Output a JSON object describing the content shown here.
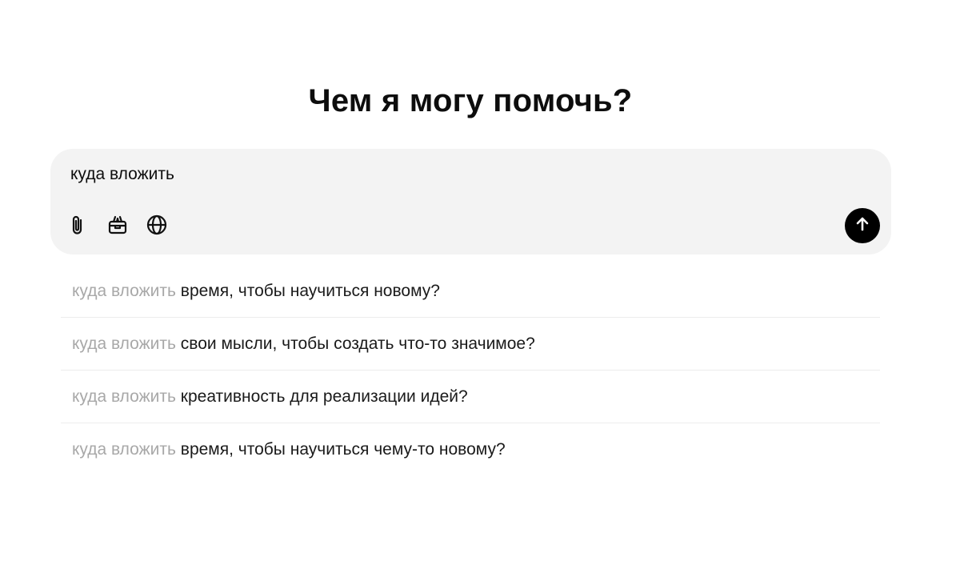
{
  "heading": "Чем я могу помочь?",
  "composer": {
    "value": "куда вложить",
    "tools": [
      {
        "icon": "paperclip-icon",
        "name": "attach-button"
      },
      {
        "icon": "toolbox-icon",
        "name": "tools-button"
      },
      {
        "icon": "globe-icon",
        "name": "web-search-button"
      }
    ],
    "send_icon": "arrow-up-icon",
    "send_color": "#000000",
    "background": "#f3f3f3"
  },
  "suggestions": [
    {
      "prefix": "куда вложить",
      "rest": "время, чтобы научиться новому?"
    },
    {
      "prefix": "куда вложить",
      "rest": "свои мысли, чтобы создать что-то значимое?"
    },
    {
      "prefix": "куда вложить",
      "rest": "креативность для реализации идей?"
    },
    {
      "prefix": "куда вложить",
      "rest": "время, чтобы научиться чему-то новому?"
    }
  ]
}
